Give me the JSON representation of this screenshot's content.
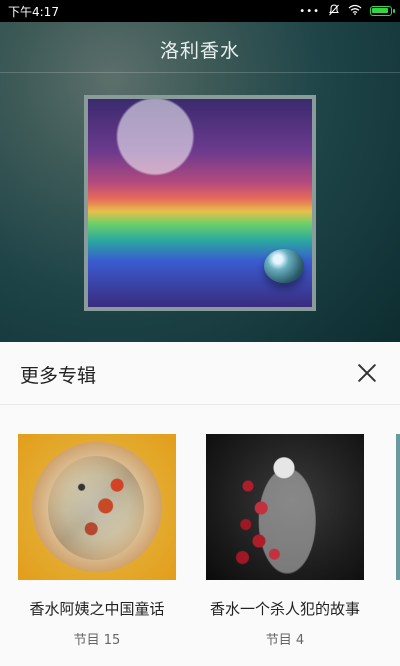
{
  "status_bar": {
    "time": "下午4:17",
    "icons": [
      "more-dots-icon",
      "mute-bell-icon",
      "wifi-icon",
      "battery-icon"
    ],
    "battery_level": 0.9
  },
  "player": {
    "title": "洛利香水"
  },
  "sheet": {
    "title": "更多专辑",
    "albums": [
      {
        "title": "香水阿姨之中国童话",
        "count": "节目 15"
      },
      {
        "title": "香水一个杀人犯的故事",
        "count": "节目 4"
      }
    ]
  },
  "colors": {
    "accent_green": "#38d14a",
    "sheet_bg": "#fafafa"
  }
}
